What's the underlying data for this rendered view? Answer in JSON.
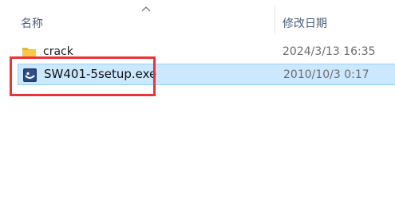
{
  "header": {
    "name_label": "名称",
    "date_label": "修改日期"
  },
  "files": [
    {
      "name": "crack",
      "type": "folder",
      "date": "2024/3/13 16:35",
      "icon": "folder-icon",
      "selected": false
    },
    {
      "name": "SW401-5setup.exe",
      "type": "exe",
      "date": "2010/10/3 0:17",
      "icon": "setup-app-icon",
      "selected": true
    }
  ],
  "colors": {
    "selection_bg": "#cce8ff",
    "selection_border": "#99d1ff",
    "annotation_box": "#e8343a",
    "folder_yellow": "#f7c948",
    "header_text": "#4c607a"
  }
}
